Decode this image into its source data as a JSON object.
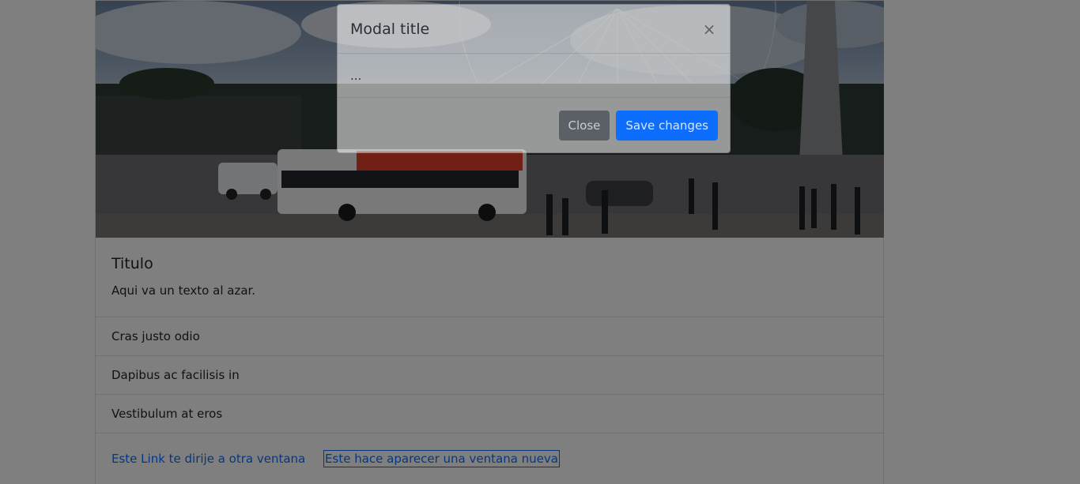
{
  "card": {
    "title": "Titulo",
    "text": "Aqui va un texto al azar.",
    "list_items": [
      "Cras justo odio",
      "Dapibus ac facilisis in",
      "Vestibulum at eros"
    ],
    "links": [
      "Este Link te dirije a otra ventana",
      "Este hace aparecer una ventana nueva"
    ]
  },
  "modal": {
    "title": "Modal title",
    "close_icon": "×",
    "body": "...",
    "close_button": "Close",
    "save_button": "Save changes"
  },
  "colors": {
    "primary": "#0d6efd",
    "secondary": "#6c757d",
    "backdrop": "rgba(0,0,0,0.5)"
  },
  "icons": {
    "close": "close-icon"
  }
}
